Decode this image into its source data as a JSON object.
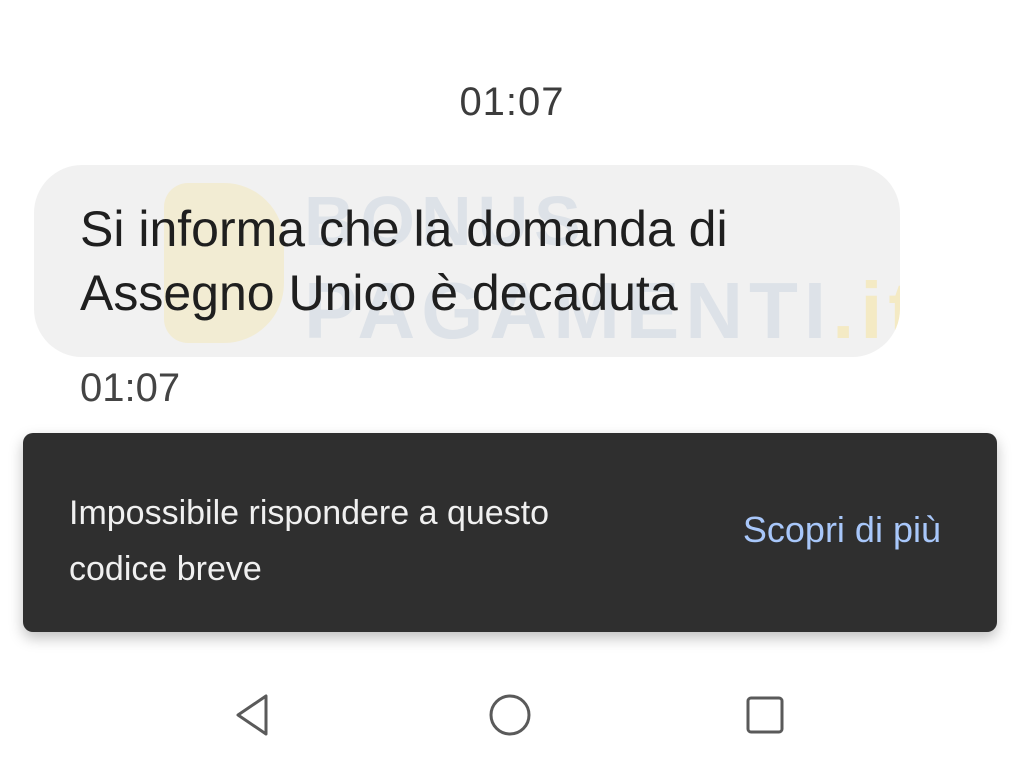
{
  "conversation": {
    "header_time": "01:07",
    "message": {
      "line1": "Si informa che la domanda di",
      "line2": "Assegno Unico è decaduta",
      "time": "01:07"
    }
  },
  "watermark": {
    "line1": "BONUS",
    "line2": "PAGAMENTI",
    "suffix": ".it"
  },
  "snackbar": {
    "line1": "Impossibile rispondere a questo",
    "line2": "codice breve",
    "action_label": "Scopri di più"
  },
  "navigation": {
    "back_icon": "back-triangle-icon",
    "home_icon": "home-circle-icon",
    "recents_icon": "recents-square-icon"
  },
  "colors": {
    "bubble": "#f1f1f1",
    "snackbar": "#2f2f2f",
    "action": "#a8c7fa"
  }
}
